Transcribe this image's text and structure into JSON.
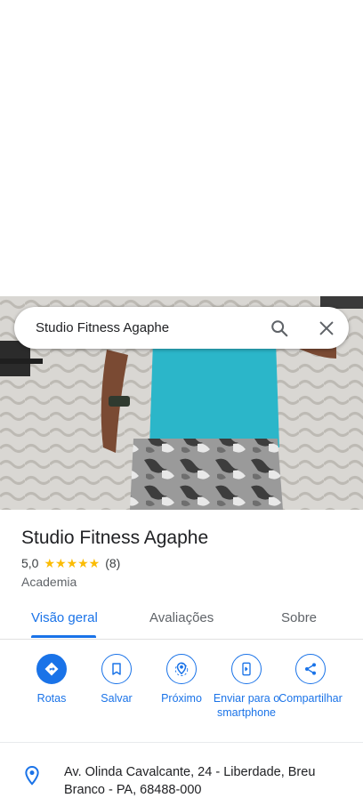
{
  "search": {
    "query": "Studio Fitness Agaphe",
    "search_icon": "search-icon",
    "close_icon": "close-icon"
  },
  "photo": {
    "alt_subject": "gym-photo"
  },
  "place": {
    "title": "Studio Fitness Agaphe",
    "rating": "5,0",
    "stars": "★★★★★",
    "reviews_count": "(8)",
    "category": "Academia"
  },
  "tabs": [
    {
      "label": "Visão geral",
      "active": true
    },
    {
      "label": "Avaliações",
      "active": false
    },
    {
      "label": "Sobre",
      "active": false
    }
  ],
  "actions": [
    {
      "label": "Rotas",
      "icon": "directions-icon"
    },
    {
      "label": "Salvar",
      "icon": "bookmark-icon"
    },
    {
      "label": "Próximo",
      "icon": "nearby-icon"
    },
    {
      "label": "Enviar para o smartphone",
      "icon": "send-to-phone-icon"
    },
    {
      "label": "Compartilhar",
      "icon": "share-icon"
    }
  ],
  "address": {
    "text": "Av. Olinda Cavalcante, 24 - Liberdade, Breu Branco - PA, 68488-000",
    "icon": "location-pin-icon"
  },
  "colors": {
    "accent": "#1a73e8",
    "star": "#fbbc04"
  }
}
